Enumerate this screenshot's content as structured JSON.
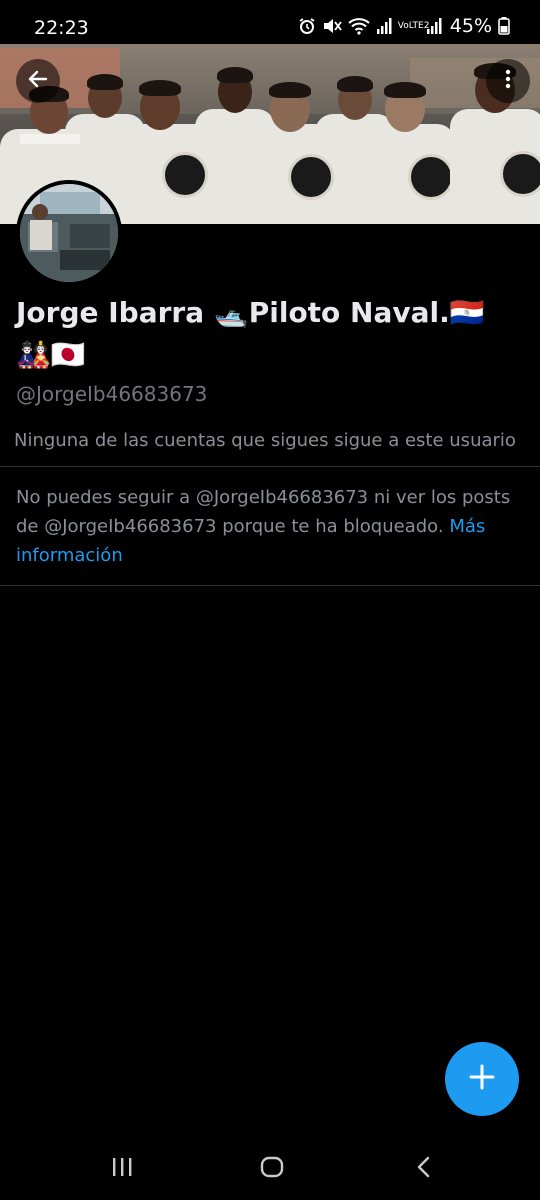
{
  "status_bar": {
    "time": "22:23",
    "network_label": "VoLTE2",
    "battery_percent": "45%",
    "icons": [
      "alarm-icon",
      "mute-icon",
      "wifi-icon",
      "signal-icon",
      "volte-icon",
      "signal-icon",
      "battery-icon"
    ]
  },
  "header": {
    "back_icon": "arrow-left-icon",
    "more_icon": "more-vertical-icon"
  },
  "profile": {
    "name": "Jorge Ibarra 🛥️Piloto Naval.🇵🇾 🎎🇯🇵",
    "handle": "@JorgeIb46683673",
    "followers_note": "Ninguna de las cuentas que sigues sigue a este usuario"
  },
  "blocked": {
    "message": "No puedes seguir a @JorgeIb46683673 ni ver los posts de @JorgeIb46683673 porque te ha bloqueado.",
    "link_text": "Más información"
  },
  "fab": {
    "icon": "plus-icon"
  },
  "nav_bar": {
    "icons": [
      "recent-apps-icon",
      "home-icon",
      "back-icon"
    ]
  },
  "colors": {
    "accent": "#1d9bf0",
    "background": "#000000",
    "secondary_text": "#71767b"
  }
}
